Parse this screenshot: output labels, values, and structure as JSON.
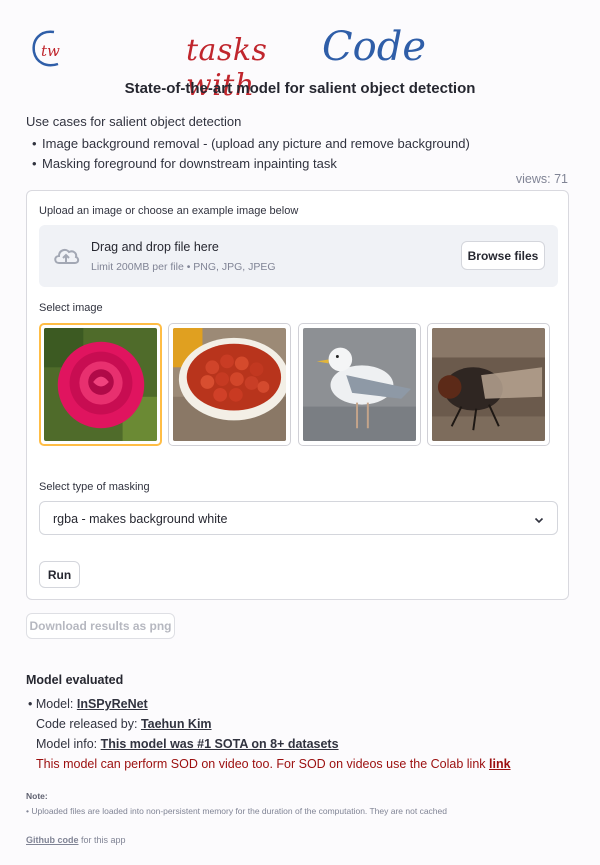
{
  "header": {
    "logo_monogram": "tw",
    "logo_word1": "tasks with",
    "logo_word2": "Code",
    "title": "State-of-the-art model for salient object detection"
  },
  "intro": {
    "heading": "Use cases for salient object detection",
    "bullets": [
      "Image background removal - (upload any picture and remove background)",
      "Masking foreground for downstream inpainting task"
    ]
  },
  "views": "views: 71",
  "upload": {
    "label": "Upload an image or choose an example image below",
    "drop_title": "Drag and drop file here",
    "drop_sub": "Limit 200MB per file • PNG, JPG, JPEG",
    "browse_label": "Browse files"
  },
  "gallery": {
    "label": "Select image",
    "images": [
      "rose-image",
      "tomatoes-image",
      "seagull-image",
      "fly-image"
    ],
    "selected_index": 0
  },
  "masking": {
    "label": "Select type of masking",
    "value": "rgba - makes background white"
  },
  "run_label": "Run",
  "download_label": "Download results as png",
  "model": {
    "heading": "Model evaluated",
    "model_prefix": "Model: ",
    "model_name": "InSPyReNet",
    "code_prefix": "Code released by: ",
    "code_author": "Taehun Kim",
    "info_prefix": "Model info: ",
    "info_link": "This model was #1 SOTA on 8+ datasets",
    "video_text": "This model can perform SOD on video too. For SOD on videos use the Colab link ",
    "video_link": "link"
  },
  "note": {
    "heading": "Note:",
    "text": "• Uploaded files are loaded into non-persistent memory for the duration of the computation. They are not cached"
  },
  "footer": {
    "link": "Github code",
    "suffix": " for this app"
  },
  "colors": {
    "accent_selected": "#ffbd45",
    "logo_red": "#c0262d",
    "logo_blue": "#2f5ea8",
    "warning_text": "#9b0e0e"
  }
}
